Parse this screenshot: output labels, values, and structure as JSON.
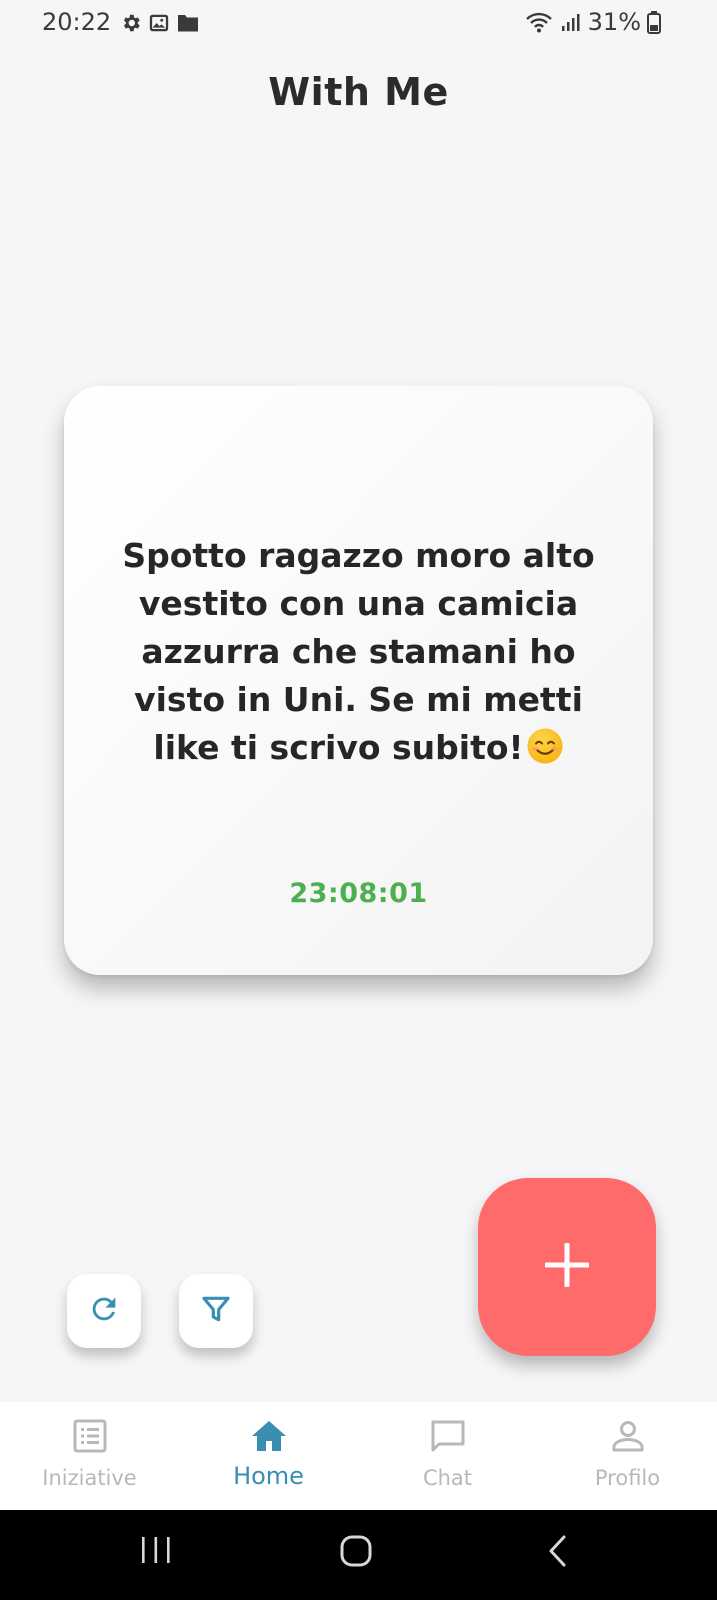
{
  "status_bar": {
    "time": "20:22",
    "battery": "31%",
    "left_icons": [
      "settings-icon",
      "image-icon",
      "folder-icon"
    ],
    "right_icons": [
      "wifi-icon",
      "signal-icon",
      "battery-icon"
    ]
  },
  "header": {
    "title": "With Me"
  },
  "post": {
    "text": "Spotto ragazzo moro alto vestito con una camicia azzurra che stamani ho visto in Uni. Se mi metti like ti scrivo subito!",
    "emoji": "smiling-face-emoji",
    "timer": "23:08:01",
    "timer_color": "#4caf50"
  },
  "actions": {
    "refresh_icon": "refresh-icon",
    "filter_icon": "filter-icon",
    "add_icon": "plus-icon",
    "fab_color": "#ff6b6b",
    "accent_color": "#3a8fb0"
  },
  "bottom_nav": {
    "items": [
      {
        "label": "Iniziative",
        "icon": "list-icon",
        "active": false
      },
      {
        "label": "Home",
        "icon": "home-icon",
        "active": true
      },
      {
        "label": "Chat",
        "icon": "chat-icon",
        "active": false
      },
      {
        "label": "Profilo",
        "icon": "person-icon",
        "active": false
      }
    ]
  },
  "system_nav": {
    "buttons": [
      "recent-apps-icon",
      "home-button-icon",
      "back-icon"
    ]
  }
}
